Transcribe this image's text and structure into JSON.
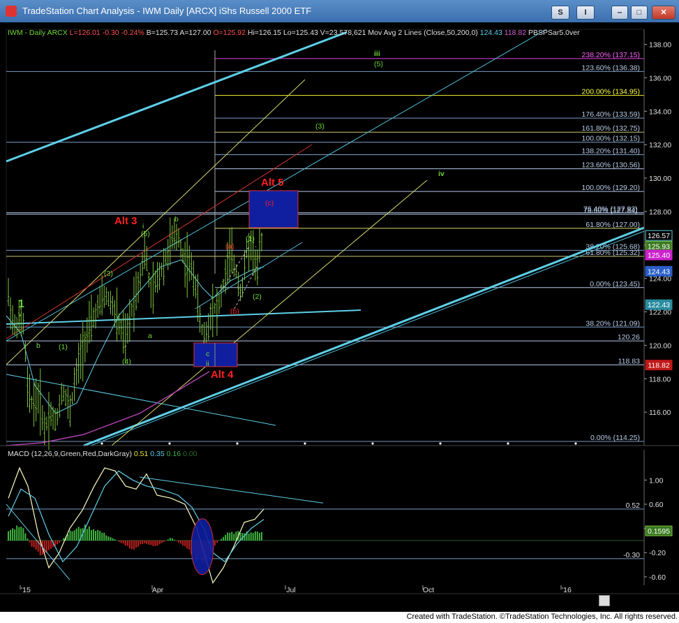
{
  "window": {
    "title": "TradeStation Chart Analysis - IWM Daily [ARCX] iShs Russell 2000 ETF",
    "buttons": {
      "s": "S",
      "i": "I",
      "minimize": "‒",
      "maximize": "□",
      "close": "✕"
    }
  },
  "footer": {
    "text": "Created with TradeStation. ©TradeStation Technologies, Inc. All rights reserved."
  },
  "colors": {
    "background": "#000000",
    "price_bars": "#7fc241",
    "fib_lines": "#7a9cc6",
    "trend_cyan": "#5ecfe8",
    "trend_yellow": "#d8d86a",
    "trend_red": "#d0342c",
    "label_green": "#6fd638",
    "label_red": "#ff2020",
    "box_blue": "#0f1fa0"
  },
  "chart_data": [
    {
      "type": "line",
      "header": {
        "symbol": "IWM - Daily",
        "exchange": "ARCX",
        "last": "L=126.01",
        "change": "-0.30",
        "change_pct": "-0.24%",
        "bid": "B=125.73",
        "ask": "A=127.00",
        "open": "O=125.92",
        "high": "Hi=126.15",
        "low": "Lo=125.43",
        "volume": "V=23,578,621",
        "study": "Mov Avg 2 Lines (Close,50,200,0)",
        "ma_fast": "124.43",
        "ma_slow": "118.82",
        "study2": "PBSPSar5.0ver"
      },
      "x_ticks": [
        "'15",
        "Apr",
        "Jul",
        "Oct",
        "'16"
      ],
      "y_ticks": [
        116.0,
        118.0,
        120.0,
        122.0,
        124.0,
        126.0,
        128.0,
        130.0,
        132.0,
        134.0,
        136.0,
        138.0
      ],
      "ylim": [
        114.0,
        138.9
      ],
      "fib_levels": [
        {
          "label": "238.20% (137.15)",
          "value": 137.15,
          "color": "#e040e0"
        },
        {
          "label": "123.60% (136.38)",
          "value": 136.38,
          "color": "#7a9cc6"
        },
        {
          "label": "200.00% (134.95)",
          "value": 134.95,
          "color": "#e8e830"
        },
        {
          "label": "176.40% (133.59)",
          "value": 133.59,
          "color": "#7a9cc6"
        },
        {
          "label": "161.80% (132.75)",
          "value": 132.75,
          "color": "#c8c870"
        },
        {
          "label": "100.00% (132.15)",
          "value": 132.15,
          "color": "#7a9cc6"
        },
        {
          "label": "138.20% (131.40)",
          "value": 131.4,
          "color": "#7a9cc6"
        },
        {
          "label": "123.60% (130.56)",
          "value": 130.56,
          "color": "#b4c8e8"
        },
        {
          "label": "100.00% (129.20)",
          "value": 129.2,
          "color": "#b4c8e8"
        },
        {
          "label": "76.40% (127.93)",
          "value": 127.93,
          "color": "#b4c8e8"
        },
        {
          "label": "78.60% (127.84)",
          "value": 127.84,
          "color": "#b4c8e8"
        },
        {
          "label": "61.80% (127.00)",
          "value": 127.0,
          "color": "#d8d86a"
        },
        {
          "label": "38.20% (125.68)",
          "value": 125.68,
          "color": "#7a9cc6"
        },
        {
          "label": "61.80% (125.32)",
          "value": 125.32,
          "color": "#c8c870"
        },
        {
          "label": "0.00% (123.45)",
          "value": 123.45,
          "color": "#b4c8e8"
        },
        {
          "label": "38.20% (121.09)",
          "value": 121.09,
          "color": "#7a9cc6"
        },
        {
          "label": "120.26",
          "value": 120.26,
          "color": "#b4c8e8"
        },
        {
          "label": "118.83",
          "value": 118.83,
          "color": "#b4c8e8"
        },
        {
          "label": "0.00% (114.25)",
          "value": 114.25,
          "color": "#7a9cc6"
        }
      ],
      "price_badges": [
        {
          "text": "126.57",
          "value": 126.57,
          "bg": "#000000",
          "fg": "#ffffff",
          "border": "#5ecfe8"
        },
        {
          "text": "125.93",
          "value": 125.93,
          "bg": "#3a7a20",
          "fg": "#ffffff",
          "border": "#7fc241"
        },
        {
          "text": "125.40",
          "value": 125.4,
          "bg": "#cc22cc",
          "fg": "#ffffff",
          "border": "#cc22cc"
        },
        {
          "text": "124.43",
          "value": 124.43,
          "bg": "#2a5fc8",
          "fg": "#ffffff",
          "border": "#2a5fc8"
        },
        {
          "text": "122.43",
          "value": 122.43,
          "bg": "#2a8ca0",
          "fg": "#ffffff",
          "border": "#2a8ca0"
        },
        {
          "text": "118.82",
          "value": 118.82,
          "bg": "#c01818",
          "fg": "#ffffff",
          "border": "#c01818"
        }
      ],
      "wave_labels": [
        {
          "text": "1",
          "color": "#6fd638",
          "bold": true,
          "size": 16
        },
        {
          "text": "v",
          "color": "#6fd638"
        },
        {
          "text": "b",
          "color": "#6fd638"
        },
        {
          "text": "(1)",
          "color": "#6fd638"
        },
        {
          "text": "(3)",
          "color": "#6fd638"
        },
        {
          "text": "(4)",
          "color": "#6fd638"
        },
        {
          "text": "(5)",
          "color": "#6fd638"
        },
        {
          "text": "i",
          "color": "#6fd638"
        },
        {
          "text": "Alt 3",
          "color": "#ff2020",
          "bold": true,
          "size": 15
        },
        {
          "text": "b",
          "color": "#6fd638"
        },
        {
          "text": "a",
          "color": "#6fd638"
        },
        {
          "text": "c",
          "color": "#6fd638"
        },
        {
          "text": "ii",
          "color": "#6fd638"
        },
        {
          "text": "Alt 4",
          "color": "#ff2020",
          "bold": true,
          "size": 15
        },
        {
          "text": "(a)",
          "color": "#ff2020"
        },
        {
          "text": "(b)",
          "color": "#ff2020"
        },
        {
          "text": "(1)",
          "color": "#6fd638"
        },
        {
          "text": "(2)",
          "color": "#6fd638"
        },
        {
          "text": "(c)",
          "color": "#ff2020"
        },
        {
          "text": "Alt 5",
          "color": "#ff2020",
          "bold": true,
          "size": 15
        },
        {
          "text": "(3)",
          "color": "#6fd638"
        },
        {
          "text": "iii",
          "color": "#6fd638",
          "bold": true
        },
        {
          "text": "(5)",
          "color": "#6fd638"
        },
        {
          "text": "iv",
          "color": "#6fd638",
          "bold": true
        }
      ],
      "moving_averages": [
        {
          "name": "MA 50",
          "color": "#5ecfe8"
        },
        {
          "name": "MA 200",
          "color": "#b040b0"
        }
      ]
    },
    {
      "type": "bar",
      "header": {
        "name": "MACD (12,26,9,Green,Red,DarkGray)",
        "macd": "0.51",
        "signal": "0.35",
        "hist": "0.16",
        "zero": "0.00"
      },
      "y_ticks": [
        1.0,
        0.6,
        0.2,
        -0.2,
        -0.6
      ],
      "ylim": [
        -0.74,
        1.5
      ],
      "levels": [
        {
          "label": "0.52",
          "value": 0.52
        },
        {
          "label": "-0.30",
          "value": -0.3
        }
      ],
      "badge": {
        "text": "0.1595",
        "value": 0.1595
      },
      "series": [
        {
          "name": "MACD",
          "color": "#ffffc0"
        },
        {
          "name": "Signal",
          "color": "#5ecfe8"
        },
        {
          "name": "Histogram",
          "color": "#3fb43f"
        }
      ]
    }
  ]
}
